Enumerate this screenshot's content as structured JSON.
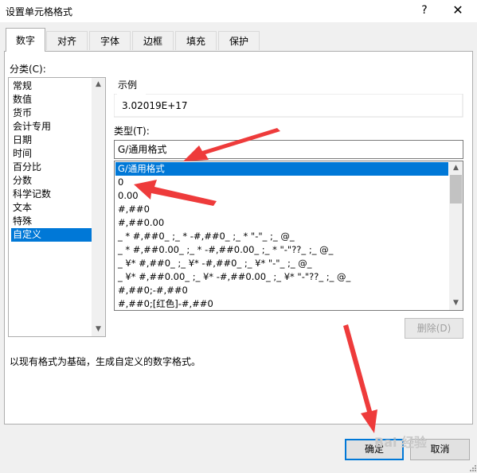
{
  "window": {
    "title": "设置单元格格式",
    "help": "?",
    "close": "✕"
  },
  "tabs": [
    {
      "label": "数字",
      "active": true
    },
    {
      "label": "对齐"
    },
    {
      "label": "字体"
    },
    {
      "label": "边框"
    },
    {
      "label": "填充"
    },
    {
      "label": "保护"
    }
  ],
  "category": {
    "label": "分类(C):",
    "items": [
      "常规",
      "数值",
      "货币",
      "会计专用",
      "日期",
      "时间",
      "百分比",
      "分数",
      "科学记数",
      "文本",
      "特殊",
      "自定义"
    ],
    "selected": "自定义"
  },
  "sample": {
    "label": "示例",
    "value": "3.02019E+17"
  },
  "type": {
    "label": "类型(T):",
    "input_value": "G/通用格式",
    "items": [
      "G/通用格式",
      "0",
      "0.00",
      "#,##0",
      "#,##0.00",
      "_ * #,##0_ ;_ * -#,##0_ ;_ * \"-\"_ ;_ @_",
      "_ * #,##0.00_ ;_ * -#,##0.00_ ;_ * \"-\"??_ ;_ @_",
      "_ ¥* #,##0_ ;_ ¥* -#,##0_ ;_ ¥* \"-\"_ ;_ @_",
      "_ ¥* #,##0.00_ ;_ ¥* -#,##0.00_ ;_ ¥* \"-\"??_ ;_ @_",
      "#,##0;-#,##0",
      "#,##0;[红色]-#,##0"
    ],
    "selected": "G/通用格式"
  },
  "delete_label": "删除(D)",
  "description": "以现有格式为基础，生成自定义的数字格式。",
  "buttons": {
    "ok": "确定",
    "cancel": "取消"
  },
  "watermark": "Bai 经验",
  "colors": {
    "accent": "#0078d7",
    "annotation_arrow": "#ee3b3b"
  }
}
